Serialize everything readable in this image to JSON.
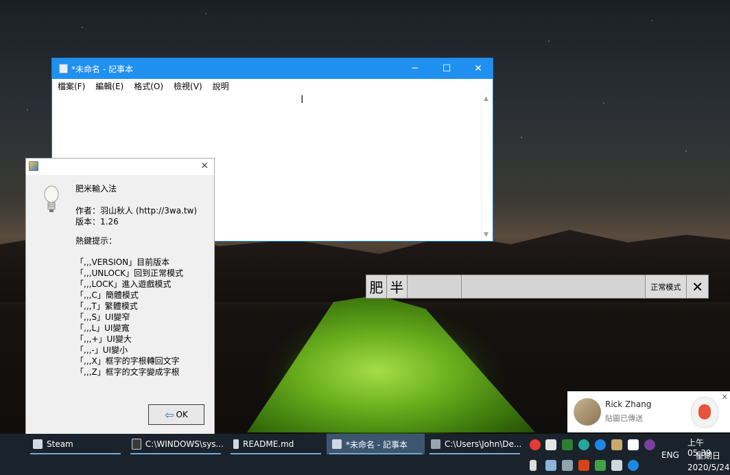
{
  "notepad": {
    "title": "*未命名 - 記事本",
    "menu": [
      "檔案(F)",
      "編輯(E)",
      "格式(O)",
      "檢視(V)",
      "說明"
    ],
    "min_glyph": "─",
    "max_glyph": "☐",
    "close_glyph": "✕",
    "caret_glyph": "I",
    "scroll_up": "▲",
    "scroll_down": "▼"
  },
  "ime_dialog": {
    "close_glyph": "✕",
    "name": "肥米輸入法",
    "author": "作者：羽山秋人 (http://3wa.tw)",
    "version": "版本：1.26",
    "hotkeys_title": "熱鍵提示：",
    "hotkeys": [
      "「,,,VERSION」目前版本",
      "「,,,UNLOCK」回到正常模式",
      "「,,,LOCK」進入遊戲模式",
      "「,,,C」簡體模式",
      "「,,,T」繁體模式",
      "「,,,S」UI變窄",
      "「,,,L」UI變寬",
      "「,,,+」UI變大",
      "「,,,-」UI變小",
      "「,,,X」框字的字根轉回文字",
      "「,,,Z」框字的文字變成字根"
    ],
    "ok_label": "OK",
    "ok_arrow": "⇦"
  },
  "ime_bar": {
    "char1": "肥",
    "char2": "半",
    "mode": "正常模式",
    "close_glyph": "✕"
  },
  "toast": {
    "name": "Rick Zhang",
    "message": "貼圖已傳送",
    "close_glyph": "✕"
  },
  "taskbar": {
    "items": [
      "Steam",
      "C:\\WINDOWS\\sys...",
      "README.md",
      "*未命名 - 記事本",
      "C:\\Users\\John\\De..."
    ],
    "language": "ENG",
    "time": "上午 05:39",
    "weekday": "星期日",
    "date": "2020/5/24"
  }
}
